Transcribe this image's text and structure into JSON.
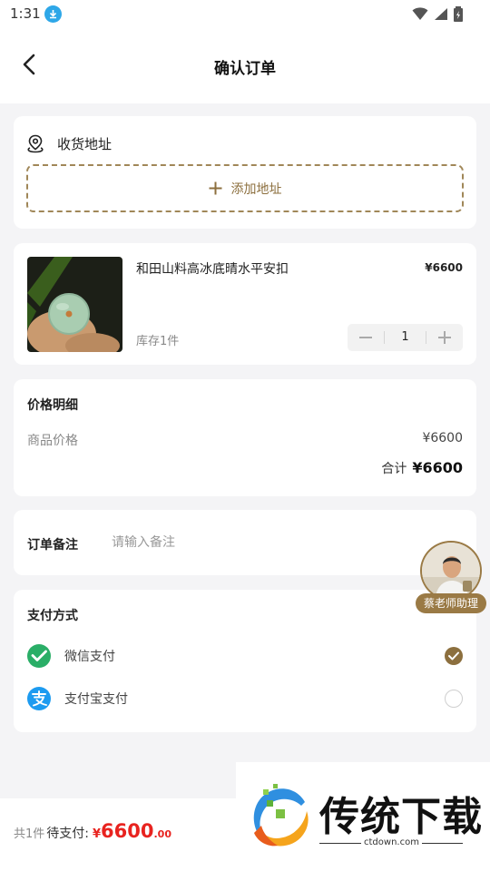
{
  "status_bar": {
    "time": "1:31",
    "icons": [
      "download-icon",
      "wifi-icon",
      "signal-icon",
      "battery-icon"
    ]
  },
  "header": {
    "title": "确认订单"
  },
  "address": {
    "title": "收货地址",
    "add_label": "添加地址"
  },
  "product": {
    "name": "和田山料高冰底晴水平安扣",
    "price": "¥6600",
    "stock": "库存1件",
    "quantity": "1"
  },
  "price_detail": {
    "title": "价格明细",
    "goods_label": "商品价格",
    "goods_value": "¥6600",
    "total_label": "合计",
    "total_value": "¥6600"
  },
  "remark": {
    "label": "订单备注",
    "placeholder": "请输入备注",
    "value": ""
  },
  "payment": {
    "title": "支付方式",
    "options": [
      {
        "label": "微信支付",
        "icon": "wechat-pay-icon",
        "selected": true
      },
      {
        "label": "支付宝支付",
        "icon": "alipay-icon",
        "selected": false
      }
    ]
  },
  "assistant": {
    "label": "蔡老师助理"
  },
  "footer": {
    "count": "共1件",
    "pending_label": "待支付:",
    "currency": "¥",
    "amount": "6600",
    "cents": ".00"
  },
  "watermark": {
    "text": "传统下载",
    "url": "ctdown.com"
  },
  "colors": {
    "accent": "#8c6f3e",
    "price_red": "#e8231f",
    "wechat_green": "#2aae67",
    "alipay_blue": "#1d9bf0"
  }
}
